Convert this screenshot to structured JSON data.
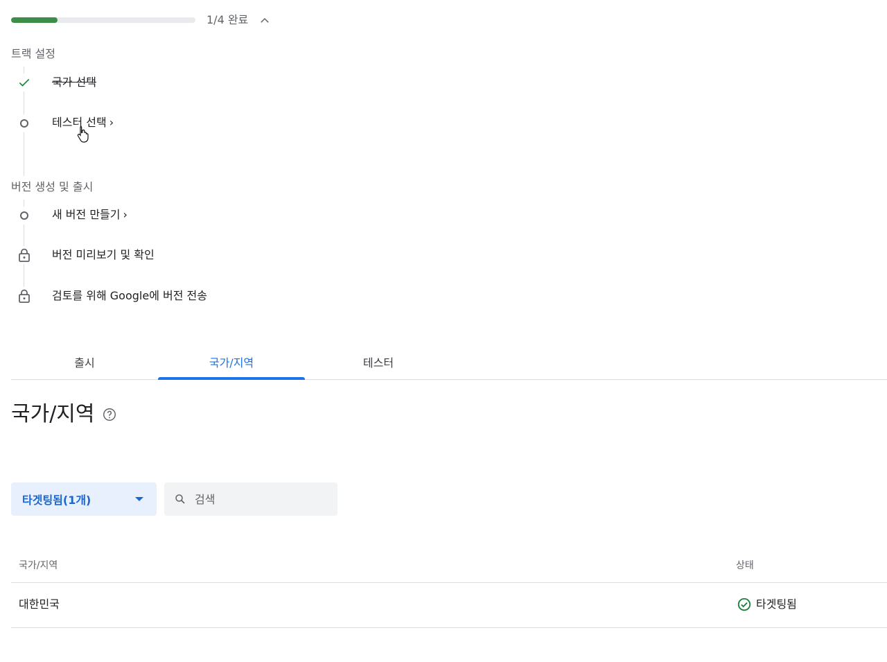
{
  "progress": {
    "fraction": 0.25,
    "text": "1/4 완료",
    "color": "#3c8d46"
  },
  "sections": [
    {
      "heading": "트랙 설정",
      "steps": [
        {
          "label": "국가 선택",
          "state": "done",
          "icon": "check-icon"
        },
        {
          "label": "테스터 선택",
          "state": "current",
          "icon": "circle-icon",
          "chevron": "›"
        }
      ]
    },
    {
      "heading": "버전 생성 및 출시",
      "steps": [
        {
          "label": "새 버전 만들기",
          "state": "current",
          "icon": "circle-icon",
          "chevron": "›"
        },
        {
          "label": "버전 미리보기 및 확인",
          "state": "locked",
          "icon": "lock-icon"
        },
        {
          "label": "검토를 위해 Google에 버전 전송",
          "state": "locked",
          "icon": "lock-icon"
        }
      ]
    }
  ],
  "tabs": [
    {
      "label": "출시",
      "active": false
    },
    {
      "label": "국가/지역",
      "active": true
    },
    {
      "label": "테스터",
      "active": false
    }
  ],
  "page_title": "국가/지역",
  "filter": {
    "label": "타겟팅됨(1개)"
  },
  "search": {
    "placeholder": "검색"
  },
  "table": {
    "headers": [
      "국가/지역",
      "상태"
    ],
    "rows": [
      {
        "country": "대한민국",
        "status": "타겟팅됨"
      }
    ]
  },
  "colors": {
    "accent": "#1a73e8",
    "success": "#188038",
    "filter_bg": "#e8f0fe"
  }
}
